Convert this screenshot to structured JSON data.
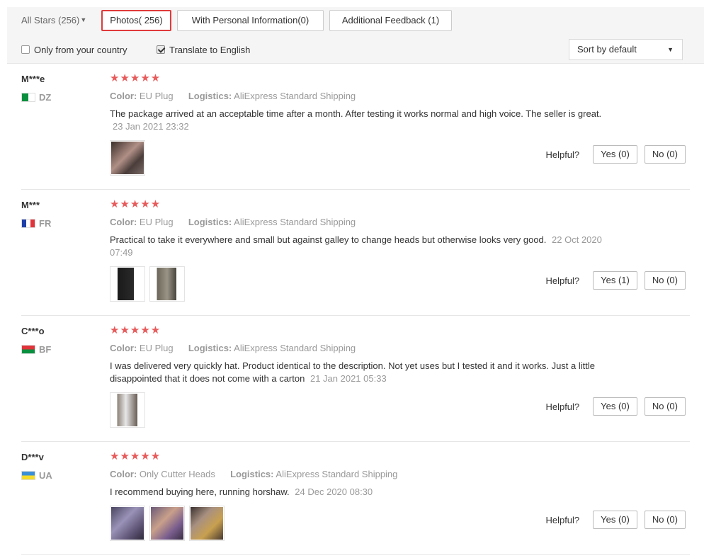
{
  "filters": {
    "all_stars": "All Stars (256)",
    "photos": "Photos( 256)",
    "personal_info": "With Personal Information(0)",
    "additional_feedback": "Additional Feedback (1)",
    "only_country": "Only from your country",
    "translate": "Translate to English",
    "sort": "Sort by default"
  },
  "labels": {
    "color": "Color:",
    "logistics": "Logistics:",
    "helpful": "Helpful?"
  },
  "colors": {
    "star": "#e85b5b",
    "active_border": "#e03a3a"
  },
  "reviews": [
    {
      "user": "M***e",
      "country": "DZ",
      "rating": 5,
      "stars": "★★★★★",
      "color": "EU Plug",
      "logistics": "AliExpress Standard Shipping",
      "text": "The package arrived at an acceptable time after a month. After testing it works normal and high voice. The seller is great.",
      "date": "23 Jan 2021 23:32",
      "yes": "Yes (0)",
      "no": "No (0)"
    },
    {
      "user": "M***",
      "country": "FR",
      "rating": 5,
      "stars": "★★★★★",
      "color": "EU Plug",
      "logistics": "AliExpress Standard Shipping",
      "text": "Practical to take it everywhere and small but against galley to change heads but otherwise looks very good.",
      "date": "22 Oct 2020 07:49",
      "yes": "Yes (1)",
      "no": "No (0)"
    },
    {
      "user": "C***o",
      "country": "BF",
      "rating": 5,
      "stars": "★★★★★",
      "color": "EU Plug",
      "logistics": "AliExpress Standard Shipping",
      "text": "I was delivered very quickly hat. Product identical to the description. Not yet uses but I tested it and it works. Just a little disappointed that it does not come with a carton",
      "date": "21 Jan 2021 05:33",
      "yes": "Yes (0)",
      "no": "No (0)"
    },
    {
      "user": "D***v",
      "country": "UA",
      "rating": 5,
      "stars": "★★★★★",
      "color": "Only Cutter Heads",
      "logistics": "AliExpress Standard Shipping",
      "text": "I recommend buying here, running horshaw.",
      "date": "24 Dec 2020 08:30",
      "yes": "Yes (0)",
      "no": "No (0)"
    }
  ]
}
